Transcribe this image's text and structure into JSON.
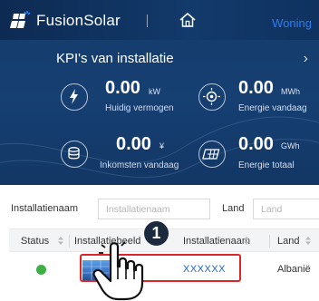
{
  "header": {
    "brand": "FusionSolar",
    "home_icon": "home-icon",
    "right_link": "Woning",
    "colors": {
      "bar": "#123a6b",
      "link": "#2a7ef0"
    }
  },
  "kpi": {
    "title": "KPI's van installatie",
    "chevron": "›",
    "items": [
      {
        "icon": "lightning-icon",
        "value": "0.00",
        "unit": "kW",
        "label": "Huidig vermogen"
      },
      {
        "icon": "sun-energy-icon",
        "value": "0.00",
        "unit": "MWh",
        "label": "Energie vandaag"
      },
      {
        "icon": "coins-icon",
        "value": "0.00",
        "unit": "¥",
        "label": "Inkomsten vandaag"
      },
      {
        "icon": "total-energy-icon",
        "value": "0.00",
        "unit": "GWh",
        "label": "Energie totaal"
      }
    ]
  },
  "filters": {
    "name_label": "Installatienaam",
    "name_placeholder": "Installatienaam",
    "land_label": "Land",
    "land_placeholder": "Land"
  },
  "table": {
    "columns": [
      "Status",
      "Installatiebeeld",
      "Installatienaam",
      "Land"
    ],
    "rows": [
      {
        "status_color": "#3cb043",
        "name": "XXXXXX",
        "land": "Albanië"
      }
    ]
  },
  "callout": {
    "step": "1",
    "highlight_color": "#e0242b"
  }
}
